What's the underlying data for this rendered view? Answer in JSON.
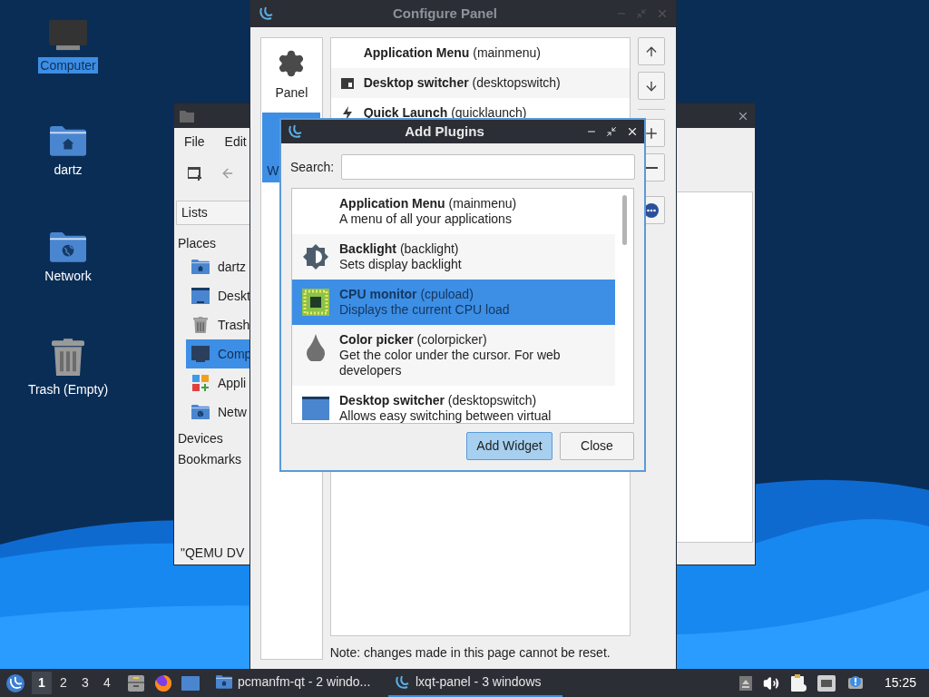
{
  "desktop_icons": [
    {
      "label": "Computer",
      "selected": true
    },
    {
      "label": "dartz",
      "selected": false
    },
    {
      "label": "Network",
      "selected": false
    },
    {
      "label": "Trash (Empty)",
      "selected": false
    }
  ],
  "file_manager": {
    "menu": [
      "File",
      "Edit"
    ],
    "side_selector": "Lists",
    "places_label": "Places",
    "places": [
      {
        "label": "dartz",
        "selected": false
      },
      {
        "label": "Deskt",
        "selected": false
      },
      {
        "label": "Trash",
        "selected": false
      },
      {
        "label": "Comp",
        "selected": true
      },
      {
        "label": "Appli",
        "selected": false
      },
      {
        "label": "Netw",
        "selected": false
      }
    ],
    "sections": [
      "Devices",
      "Bookmarks"
    ],
    "status": "\"QEMU DV"
  },
  "configure_panel": {
    "title": "Configure Panel",
    "pages": [
      {
        "label": "Panel",
        "selected": false
      },
      {
        "label": "W",
        "selected": true
      }
    ],
    "widgets": [
      "**Application Menu** (mainmenu)",
      "**Desktop switcher** (desktopswitch)",
      "**Quick Launch** (quicklaunch)"
    ],
    "note": "Note: changes made in this page cannot be reset."
  },
  "add_plugins": {
    "title": "Add Plugins",
    "search_label": "Search:",
    "plugins": [
      {
        "title": "**Application Menu** (mainmenu)",
        "description": "A menu of all your applications",
        "selected": false
      },
      {
        "title": "**Backlight** (backlight)",
        "description": "Sets display backlight",
        "selected": false
      },
      {
        "title": "**CPU monitor** (cpuload)",
        "description": "Displays the current CPU load",
        "selected": true
      },
      {
        "title": "**Color picker** (colorpicker)",
        "description": "Get the color under the cursor. For web developers",
        "selected": false
      },
      {
        "title": "**Desktop switcher** (desktopswitch)",
        "description": "Allows easy switching between virtual",
        "selected": false
      }
    ],
    "buttons": [
      {
        "label": "Add Widget",
        "default": true
      },
      {
        "label": "Close",
        "default": false
      }
    ]
  },
  "taskbar": {
    "desktops": [
      {
        "label": "1",
        "selected": true
      },
      {
        "label": "2",
        "selected": false
      },
      {
        "label": "3",
        "selected": false
      },
      {
        "label": "4",
        "selected": false
      }
    ],
    "tasks": [
      {
        "label": "pcmanfm-qt - 2 windo...",
        "selected": false
      },
      {
        "label": "lxqt-panel - 3 windows",
        "selected": true
      }
    ],
    "clock": "15:25"
  }
}
